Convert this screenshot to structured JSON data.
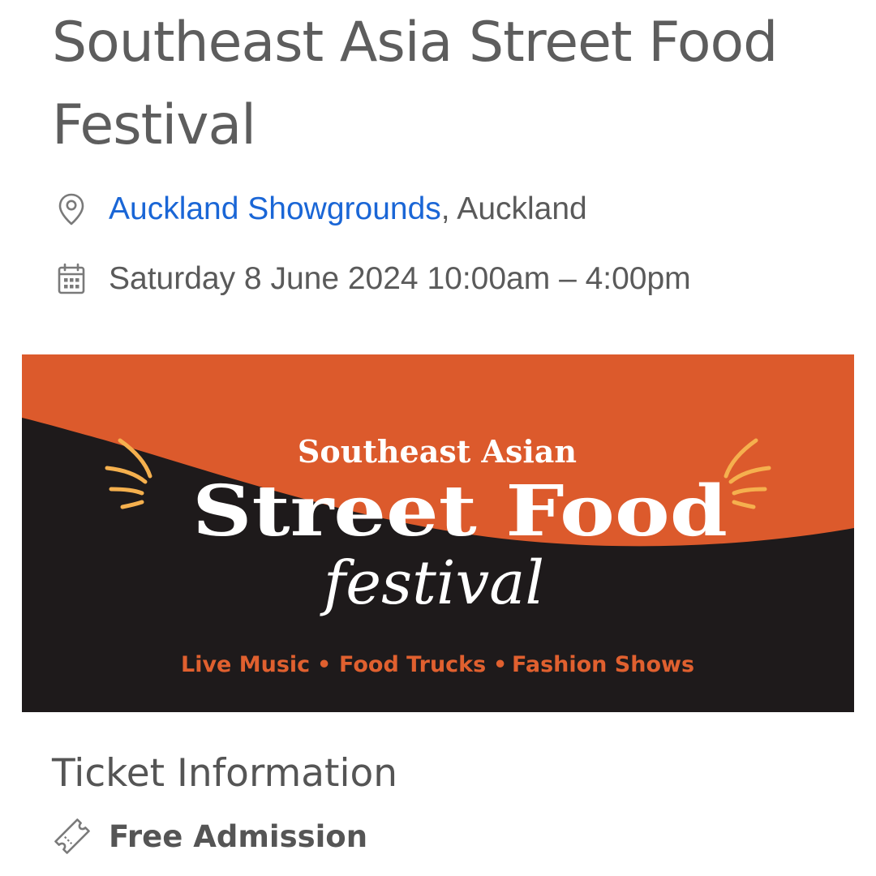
{
  "event": {
    "title": "Southeast Asia Street Food Festival",
    "venue_link": "Auckland Showgrounds",
    "venue_suffix": ", Auckland",
    "datetime": "Saturday 8 June 2024 10:00am – 4:00pm"
  },
  "banner": {
    "line1": "Southeast Asian",
    "line2": "Street Food",
    "line3": "festival",
    "tagline": {
      "item1": "Live Music",
      "item2": "Food Trucks",
      "item3": "Fashion Shows",
      "separator": "•"
    },
    "colors": {
      "orange": "#dc5a2c",
      "dark": "#1e1a1b",
      "accent": "#f5b04e",
      "text": "#ffffff",
      "tagline": "#e0602f"
    }
  },
  "tickets": {
    "heading": "Ticket Information",
    "admission": "Free Admission"
  },
  "icons": {
    "location": "map-pin-icon",
    "date": "calendar-icon",
    "ticket": "ticket-icon"
  },
  "colors": {
    "link": "#1a66d6",
    "text": "#555555"
  }
}
